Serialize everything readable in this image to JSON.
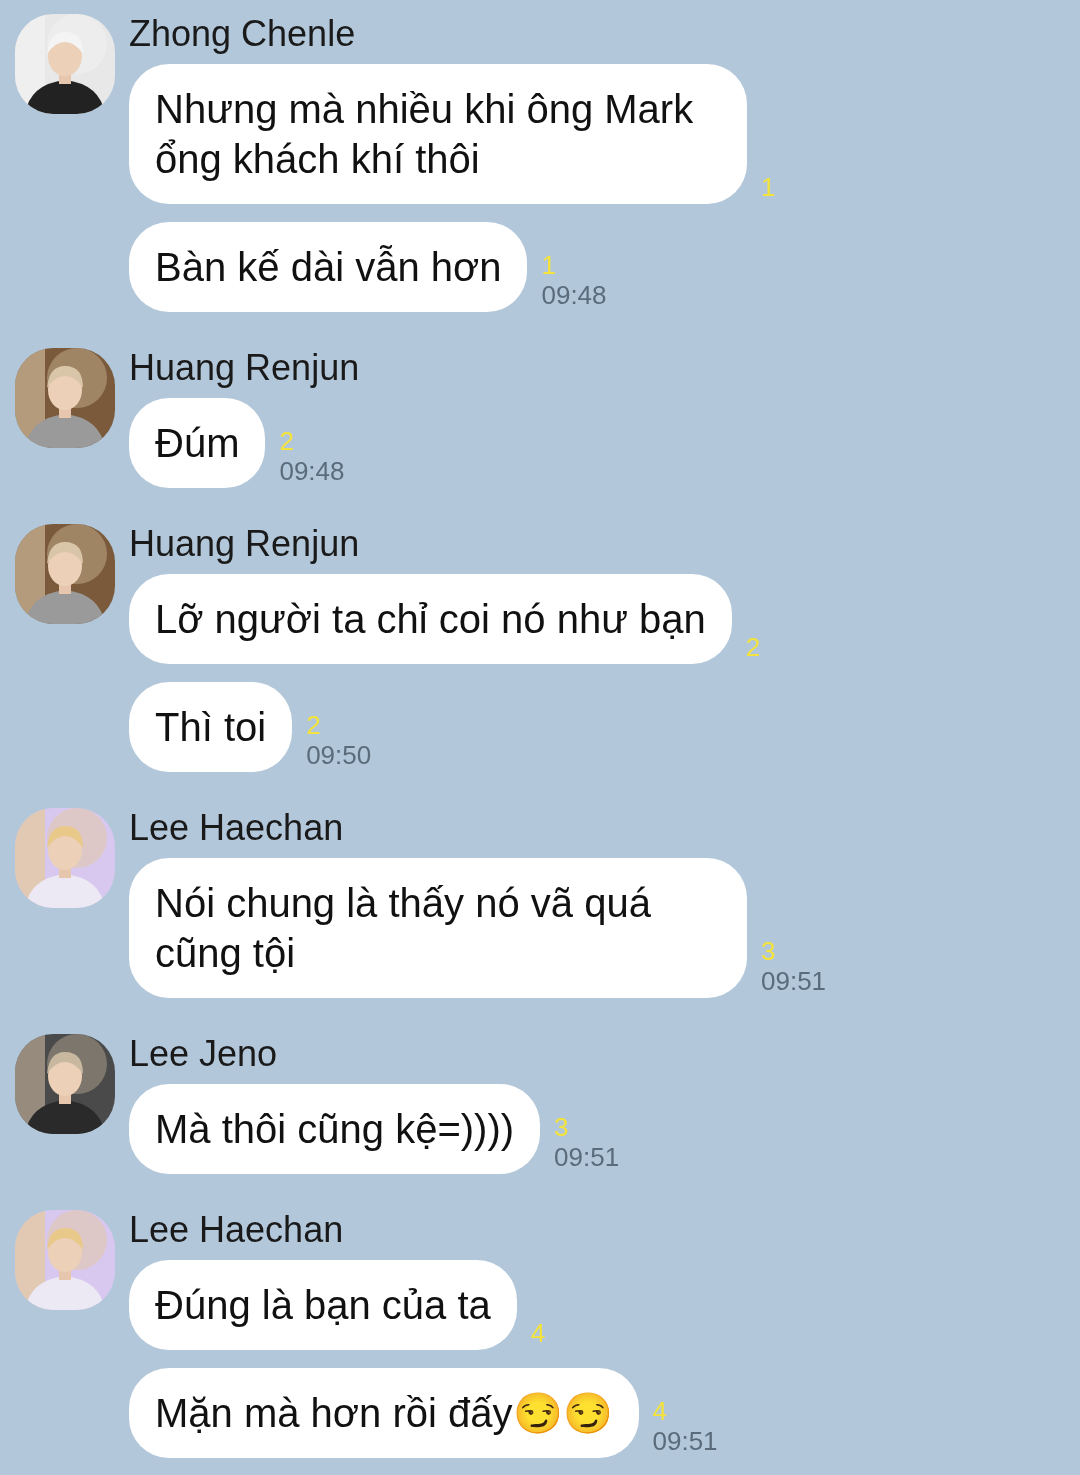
{
  "groups": [
    {
      "sender": "Zhong Chenle",
      "avatar": {
        "kind": "picture"
      },
      "messages": [
        {
          "text": "Nhưng mà nhiều khi ông Mark ổng khách khí thôi",
          "read_count": "1"
        },
        {
          "text": "Bàn kế dài vẫn hơn",
          "read_count": "1",
          "time": "09:48"
        }
      ]
    },
    {
      "sender": "Huang Renjun",
      "avatar": {
        "kind": "picture"
      },
      "messages": [
        {
          "text": "Đúm",
          "read_count": "2",
          "time": "09:48"
        }
      ]
    },
    {
      "sender": "Huang Renjun",
      "avatar": {
        "kind": "picture"
      },
      "messages": [
        {
          "text": "Lỡ người ta chỉ coi nó như bạn",
          "read_count": "2"
        },
        {
          "text": "Thì toi",
          "read_count": "2",
          "time": "09:50"
        }
      ]
    },
    {
      "sender": "Lee Haechan",
      "avatar": {
        "kind": "picture"
      },
      "messages": [
        {
          "text": "Nói chung là thấy nó vã quá cũng tội",
          "read_count": "3",
          "time": "09:51"
        }
      ]
    },
    {
      "sender": "Lee Jeno",
      "avatar": {
        "kind": "picture"
      },
      "messages": [
        {
          "text": "Mà thôi cũng kệ=))))",
          "read_count": "3",
          "time": "09:51"
        }
      ]
    },
    {
      "sender": "Lee Haechan",
      "avatar": {
        "kind": "picture"
      },
      "messages": [
        {
          "text": "Đúng là bạn của ta",
          "read_count": "4"
        },
        {
          "text": "Mặn mà hơn rồi đấy😏😏",
          "read_count": "4",
          "time": "09:51"
        }
      ]
    }
  ]
}
